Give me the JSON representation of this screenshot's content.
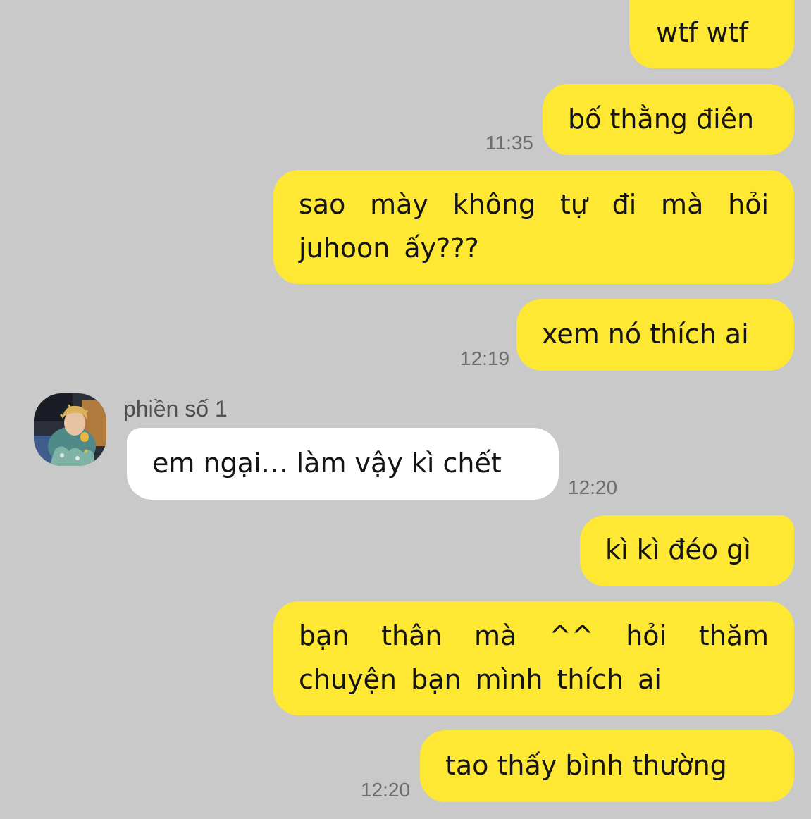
{
  "messages": [
    {
      "side": "me",
      "text": "wtf wtf",
      "time": ""
    },
    {
      "side": "me",
      "text": "bố thằng điên",
      "time": "11:35"
    },
    {
      "side": "me",
      "text": "sao mày không tự đi mà hỏi juhoon ấy???",
      "time": ""
    },
    {
      "side": "me",
      "text": "xem nó thích ai",
      "time": "12:19"
    },
    {
      "side": "other",
      "sender": "phiền số 1",
      "text": "em ngại… làm vậy kì chết",
      "time": "12:20"
    },
    {
      "side": "me",
      "text": "kì kì đéo gì",
      "time": ""
    },
    {
      "side": "me",
      "text": "bạn thân mà ^^ hỏi thăm chuyện bạn mình thích ai",
      "time": ""
    },
    {
      "side": "me",
      "text": "tao thấy bình thường",
      "time": "12:20"
    }
  ],
  "contact": {
    "name": "phiền số 1",
    "avatar_icon": "user-avatar-photo"
  },
  "colors": {
    "background": "#c9c9c9",
    "my_bubble": "#fee833",
    "their_bubble": "#ffffff",
    "timestamp": "#6d6d6d"
  }
}
